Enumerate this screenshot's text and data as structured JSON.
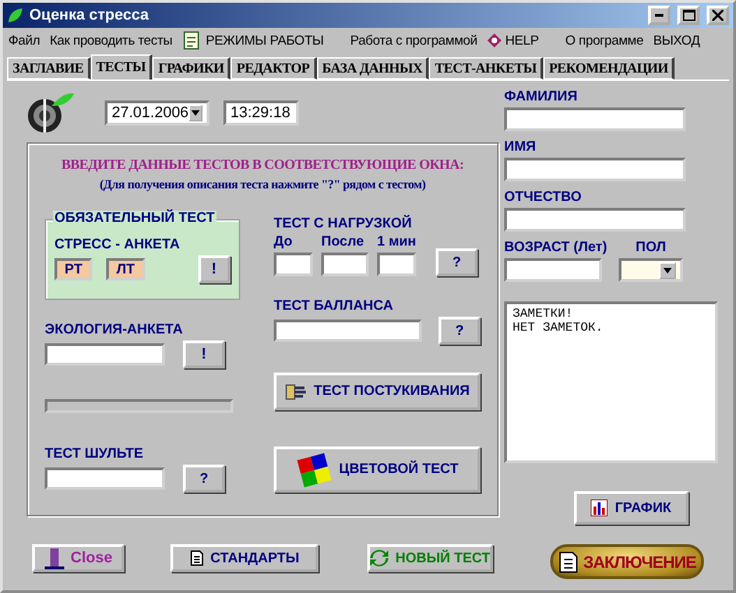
{
  "window": {
    "title": "Оценка стресса"
  },
  "menu": [
    {
      "label": "Файл",
      "kind": "text"
    },
    {
      "label": "Как проводить тесты",
      "kind": "text"
    },
    {
      "label": "РЕЖИМЫ РАБОТЫ",
      "kind": "notepad"
    },
    {
      "label": "Работа с программой",
      "kind": "text"
    },
    {
      "label": "HELP",
      "kind": "help"
    },
    {
      "label": "О программе",
      "kind": "text"
    },
    {
      "label": "ВЫХОД",
      "kind": "text"
    }
  ],
  "tabs": [
    {
      "label": "ЗАГЛАВИЕ",
      "selected": false
    },
    {
      "label": "ТЕСТЫ",
      "selected": true
    },
    {
      "label": "ГРАФИКИ",
      "selected": false
    },
    {
      "label": "РЕДАКТОР",
      "selected": false
    },
    {
      "label": "БАЗА ДАННЫХ",
      "selected": false
    },
    {
      "label": "ТЕСТ-АНКЕТЫ",
      "selected": false
    },
    {
      "label": "РЕКОМЕНДАЦИИ",
      "selected": false
    }
  ],
  "date": "27.01.2006",
  "time": "13:29:18",
  "instructions": {
    "title": "ВВЕДИТЕ ДАННЫЕ ТЕСТОВ В СООТВЕТСТВУЮЩИЕ ОКНА:",
    "hint": "(Для получения описания теста нажмите \"?\" рядом с тестом)"
  },
  "mandatory": {
    "title": "ОБЯЗАТЕЛЬНЫЙ ТЕСТ",
    "subtitle": "СТРЕСС -  АНКЕТА",
    "cells": [
      "РТ",
      "ЛТ"
    ],
    "button": "!"
  },
  "ecology": {
    "label": "ЭКОЛОГИЯ-АНКЕТА",
    "button": "!"
  },
  "progress": {
    "level": 0
  },
  "schulte": {
    "label": "ТЕСТ ШУЛЬТЕ",
    "button": "?"
  },
  "load_test": {
    "label": "ТЕСТ С НАГРУЗКОЙ",
    "columns": [
      "До",
      "После",
      "1 мин"
    ],
    "button": "?"
  },
  "balance": {
    "label": "ТЕСТ БАЛЛАНСА",
    "button": "?"
  },
  "tapping_button": "ТЕСТ ПОСТУКИВАНИЯ",
  "color_test_button": "ЦВЕТОВОЙ ТЕСТ",
  "person": {
    "fields": [
      "ФАМИЛИЯ",
      "ИМЯ",
      "ОТЧЕСТВО"
    ],
    "age": "ВОЗРАСТ (Лет)",
    "sex": "ПОЛ"
  },
  "notes": [
    "ЗАМЕТКИ!",
    "НЕТ ЗАМЕТОК."
  ],
  "graph_button": "ГРАФИК",
  "bottom_buttons": [
    {
      "label": "Close",
      "kind": "close"
    },
    {
      "label": "СТАНДАРТЫ",
      "kind": "standards"
    },
    {
      "label": "НОВЫЙ ТЕСТ",
      "kind": "new"
    }
  ],
  "conclusion_button": "ЗАКЛЮЧЕНИЕ"
}
